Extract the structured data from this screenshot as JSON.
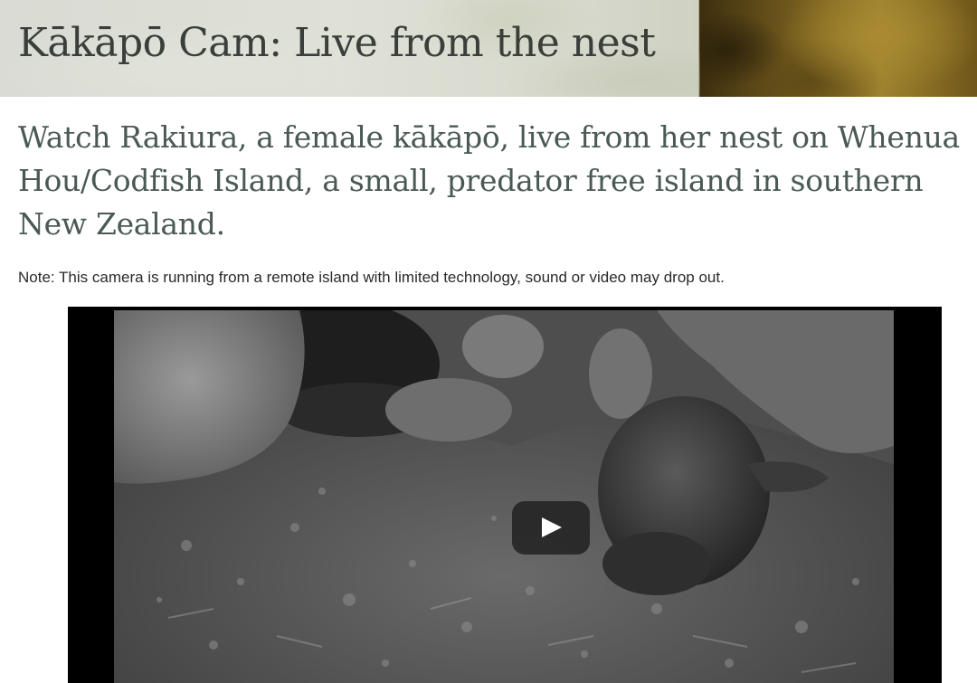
{
  "header": {
    "title": "Kākāpō Cam: Live from the nest"
  },
  "intro": {
    "text": "Watch Rakiura, a female kākāpō, live from her nest on Whenua Hou/Codfish Island, a small, predator free island in southern New Zealand."
  },
  "note": {
    "text": "Note: This camera is running from a remote island with limited technology, sound or video may drop out."
  },
  "video": {
    "play_icon": "play-icon",
    "button_color": "#212121"
  }
}
